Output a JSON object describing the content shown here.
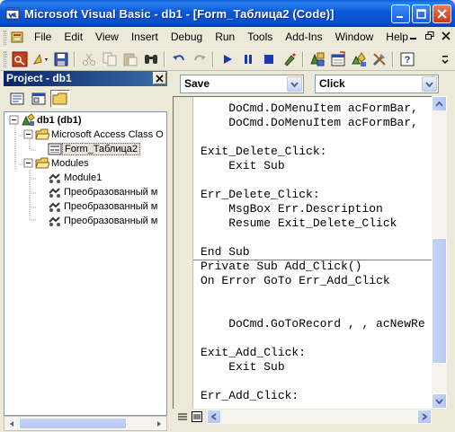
{
  "window": {
    "title": "Microsoft Visual Basic - db1 - [Form_Таблица2 (Code)]"
  },
  "menu": {
    "items": [
      {
        "label": "File"
      },
      {
        "label": "Edit"
      },
      {
        "label": "View"
      },
      {
        "label": "Insert"
      },
      {
        "label": "Debug"
      },
      {
        "label": "Run"
      },
      {
        "label": "Tools"
      },
      {
        "label": "Add-Ins"
      },
      {
        "label": "Window"
      },
      {
        "label": "Help"
      }
    ]
  },
  "project": {
    "title": "Project - db1",
    "tree": {
      "root": "db1 (db1)",
      "folder1": "Microsoft Access Class O",
      "form": "Form_Таблица2",
      "folder2": "Modules",
      "module1": "Module1",
      "conv1": "Преобразованный м",
      "conv2": "Преобразованный м",
      "conv3": "Преобразованный м"
    }
  },
  "code": {
    "object_combo": "Save",
    "procedure_combo": "Click",
    "lines": [
      "    DoCmd.DoMenuItem acFormBar,",
      "    DoCmd.DoMenuItem acFormBar,",
      "",
      "Exit_Delete_Click:",
      "    Exit Sub",
      "",
      "Err_Delete_Click:",
      "    MsgBox Err.Description",
      "    Resume Exit_Delete_Click",
      "",
      "End Sub",
      "Private Sub Add_Click()",
      "On Error GoTo Err_Add_Click",
      "",
      "",
      "    DoCmd.GoToRecord , , acNewRe",
      "",
      "Exit_Add_Click:",
      "    Exit Sub",
      "",
      "Err_Add_Click:"
    ]
  }
}
